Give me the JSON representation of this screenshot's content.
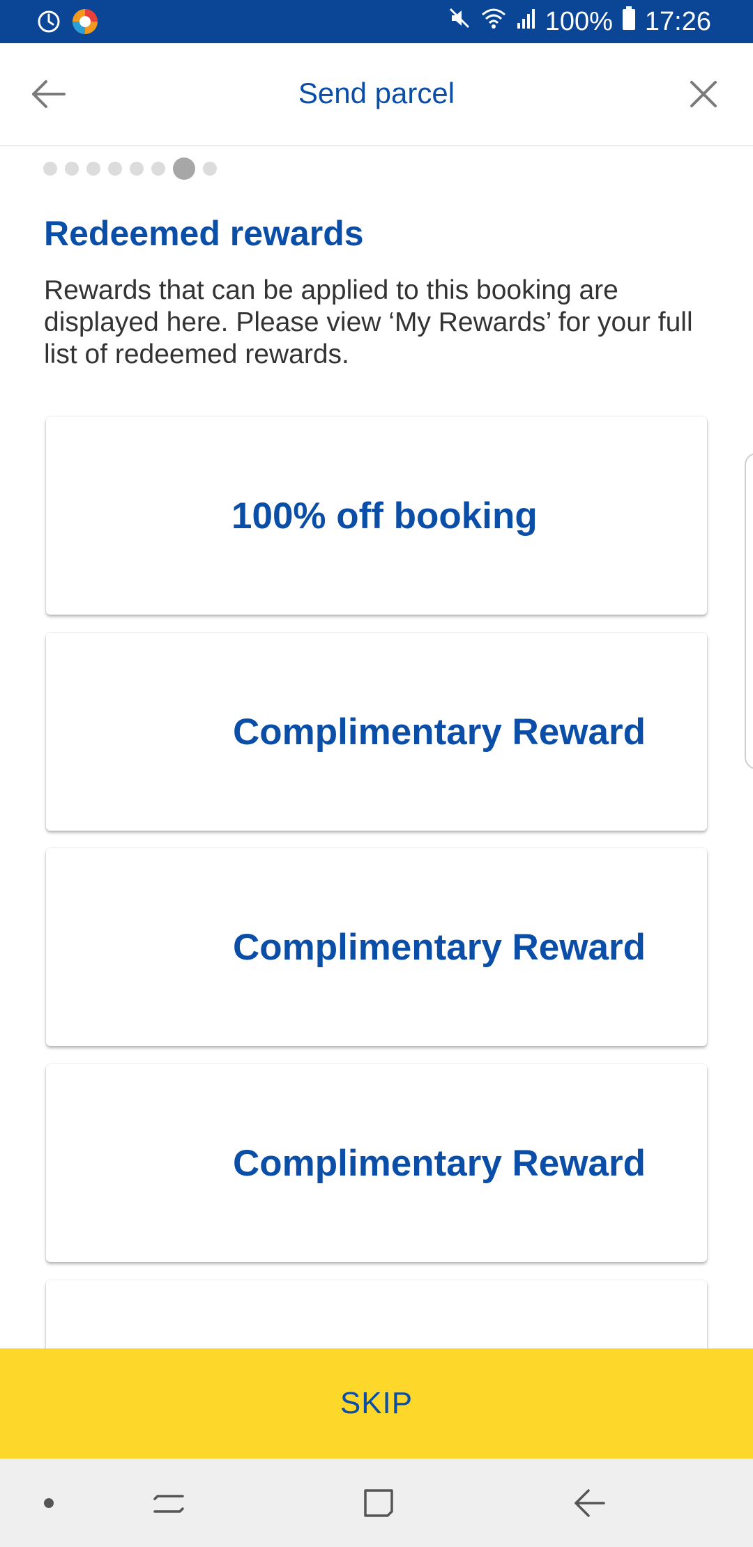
{
  "status_bar": {
    "battery": "100%",
    "time": "17:26",
    "icons": [
      "sync-icon",
      "browser-app-icon",
      "mute-icon",
      "wifi-icon",
      "signal-icon",
      "battery-icon"
    ]
  },
  "header": {
    "title": "Send parcel",
    "back_icon": "arrow-left-icon",
    "close_icon": "close-icon"
  },
  "progress": {
    "total_steps": 8,
    "current_step": 7
  },
  "main": {
    "title": "Redeemed rewards",
    "description": "Rewards that can be applied to this booking are displayed here. Please view ‘My Rewards’ for your full list of redeemed rewards.",
    "rewards": [
      {
        "label": "100% off booking"
      },
      {
        "label": "Complimentary Reward"
      },
      {
        "label": "Complimentary Reward"
      },
      {
        "label": "Complimentary Reward"
      },
      {
        "label": ""
      }
    ]
  },
  "footer": {
    "skip_label": "SKIP"
  },
  "nav_bar": {
    "icons": [
      "dot-icon",
      "recents-icon",
      "home-icon",
      "back-icon"
    ]
  },
  "colors": {
    "status_bar": "#0a4596",
    "accent_blue": "#0a4ea8",
    "skip_yellow": "#fdd82a",
    "nav_bg": "#efefef"
  }
}
